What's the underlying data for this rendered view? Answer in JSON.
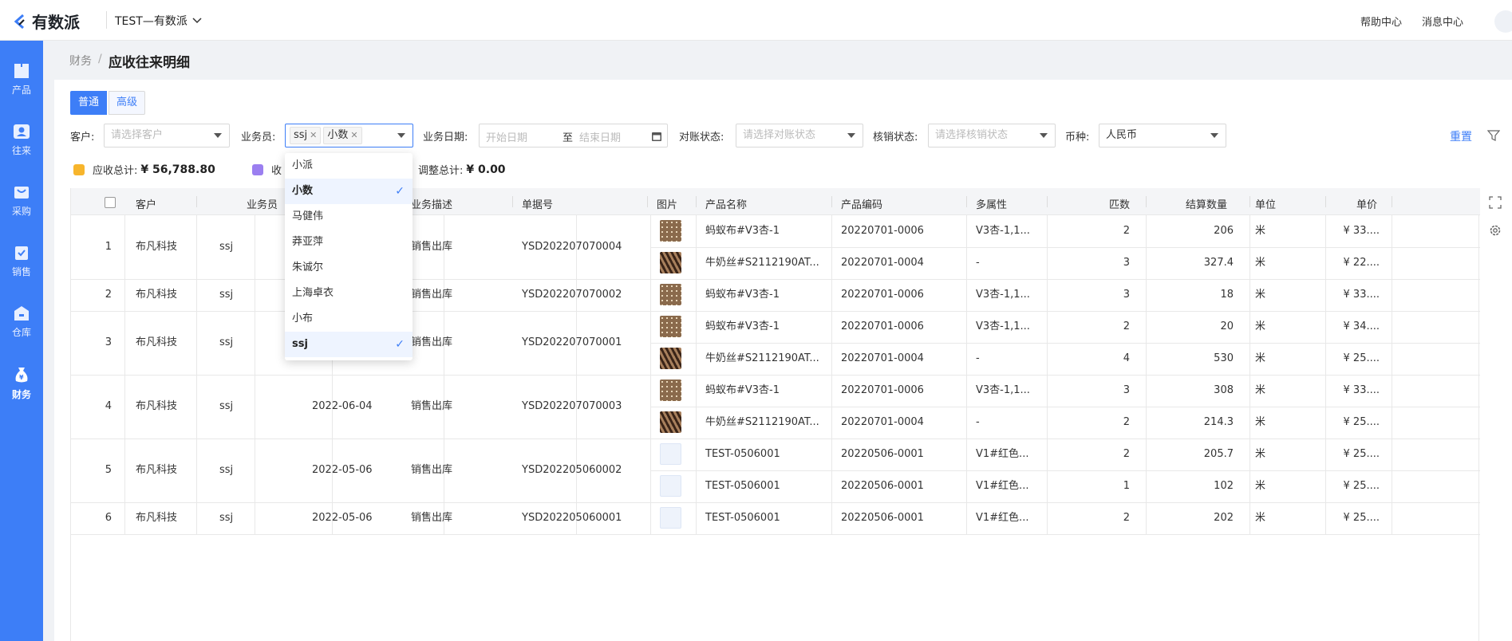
{
  "app": {
    "logo_text": "有数派",
    "tenant": "TEST—有数派",
    "help": "帮助中心",
    "messages": "消息中心"
  },
  "sidebar": {
    "items": [
      {
        "label": "产品",
        "icon": "box-icon"
      },
      {
        "label": "往来",
        "icon": "contact-icon"
      },
      {
        "label": "采购",
        "icon": "cart-icon"
      },
      {
        "label": "销售",
        "icon": "sales-icon"
      },
      {
        "label": "仓库",
        "icon": "warehouse-icon"
      },
      {
        "label": "财务",
        "icon": "money-bag-icon",
        "active": true
      }
    ]
  },
  "breadcrumb": {
    "parent": "财务",
    "sep": "/",
    "current": "应收往来明细"
  },
  "mode_tabs": {
    "normal": "普通",
    "advanced": "高级"
  },
  "filters": {
    "customer": {
      "label": "客户:",
      "placeholder": "请选择客户"
    },
    "salesman": {
      "label": "业务员:",
      "tags": [
        "ssj",
        "小数"
      ]
    },
    "date": {
      "label": "业务日期:",
      "start": "开始日期",
      "sep": "至",
      "end": "结束日期"
    },
    "reconcile": {
      "label": "对账状态:",
      "placeholder": "请选择对账状态"
    },
    "writeoff": {
      "label": "核销状态:",
      "placeholder": "请选择核销状态"
    },
    "currency": {
      "label": "币种:",
      "value": "人民币"
    },
    "reset": "重置"
  },
  "summary": {
    "receivable_label": "应收总计:",
    "receivable_value": "¥ 56,788.80",
    "received_label": "收",
    "adjust_label": "调整总计:",
    "adjust_value": "¥ 0.00"
  },
  "salesman_dropdown": {
    "options": [
      {
        "label": "小派",
        "selected": false
      },
      {
        "label": "小数",
        "selected": true
      },
      {
        "label": "马健伟",
        "selected": false
      },
      {
        "label": "莽亚萍",
        "selected": false
      },
      {
        "label": "朱诚尔",
        "selected": false
      },
      {
        "label": "上海卓衣",
        "selected": false
      },
      {
        "label": "小布",
        "selected": false
      },
      {
        "label": "ssj",
        "selected": true
      }
    ]
  },
  "table": {
    "columns": [
      "客户",
      "业务员",
      "业务描述",
      "单据号",
      "图片",
      "产品名称",
      "产品编码",
      "多属性",
      "匹数",
      "结算数量",
      "单位",
      "单价"
    ],
    "groups": [
      {
        "no": "1",
        "customer": "布凡科技",
        "salesman": "ssj",
        "date": "",
        "desc": "销售出库",
        "doc": "YSD202207070004"
      },
      {
        "no": "2",
        "customer": "布凡科技",
        "salesman": "ssj",
        "date": "",
        "desc": "销售出库",
        "doc": "YSD202207070002"
      },
      {
        "no": "3",
        "customer": "布凡科技",
        "salesman": "ssj",
        "date": "",
        "desc": "销售出库",
        "doc": "YSD202207070001"
      },
      {
        "no": "4",
        "customer": "布凡科技",
        "salesman": "ssj",
        "date": "2022-06-04",
        "desc": "销售出库",
        "doc": "YSD202207070003"
      },
      {
        "no": "5",
        "customer": "布凡科技",
        "salesman": "ssj",
        "date": "2022-05-06",
        "desc": "销售出库",
        "doc": "YSD202205060002"
      },
      {
        "no": "6",
        "customer": "布凡科技",
        "salesman": "ssj",
        "date": "2022-05-06",
        "desc": "销售出库",
        "doc": "YSD202205060001"
      }
    ],
    "items": [
      {
        "img": "dots",
        "name": "蚂蚁布#V3杏-1",
        "code": "20220701-0006",
        "attr": "V3杏-1,1...",
        "pieces": "2",
        "qty": "206",
        "unit": "米",
        "price": "¥ 33...."
      },
      {
        "img": "waves",
        "name": "牛奶丝#S2112190AT...",
        "code": "20220701-0004",
        "attr": "-",
        "pieces": "3",
        "qty": "327.4",
        "unit": "米",
        "price": "¥ 22...."
      },
      {
        "img": "dots",
        "name": "蚂蚁布#V3杏-1",
        "code": "20220701-0006",
        "attr": "V3杏-1,1...",
        "pieces": "3",
        "qty": "18",
        "unit": "米",
        "price": "¥ 33...."
      },
      {
        "img": "dots",
        "name": "蚂蚁布#V3杏-1",
        "code": "20220701-0006",
        "attr": "V3杏-1,1...",
        "pieces": "2",
        "qty": "20",
        "unit": "米",
        "price": "¥ 34...."
      },
      {
        "img": "waves",
        "name": "牛奶丝#S2112190AT...",
        "code": "20220701-0004",
        "attr": "-",
        "pieces": "4",
        "qty": "530",
        "unit": "米",
        "price": "¥ 25...."
      },
      {
        "img": "dots",
        "name": "蚂蚁布#V3杏-1",
        "code": "20220701-0006",
        "attr": "V3杏-1,1...",
        "pieces": "3",
        "qty": "308",
        "unit": "米",
        "price": "¥ 33...."
      },
      {
        "img": "waves",
        "name": "牛奶丝#S2112190AT...",
        "code": "20220701-0004",
        "attr": "-",
        "pieces": "2",
        "qty": "214.3",
        "unit": "米",
        "price": "¥ 25...."
      },
      {
        "img": "ph",
        "name": "TEST-0506001",
        "code": "20220506-0001",
        "attr": "V1#红色...",
        "pieces": "2",
        "qty": "205.7",
        "unit": "米",
        "price": "¥ 25...."
      },
      {
        "img": "ph",
        "name": "TEST-0506001",
        "code": "20220506-0001",
        "attr": "V1#红色...",
        "pieces": "1",
        "qty": "102",
        "unit": "米",
        "price": "¥ 25...."
      },
      {
        "img": "ph",
        "name": "TEST-0506001",
        "code": "20220506-0001",
        "attr": "V1#红色...",
        "pieces": "2",
        "qty": "202",
        "unit": "米",
        "price": "¥ 25...."
      }
    ]
  },
  "colors": {
    "primary": "#3d7ef7",
    "sidebar": "#3d7ef7",
    "stat_yellow": "#f7b52c",
    "stat_purple": "#9b7ff0"
  }
}
